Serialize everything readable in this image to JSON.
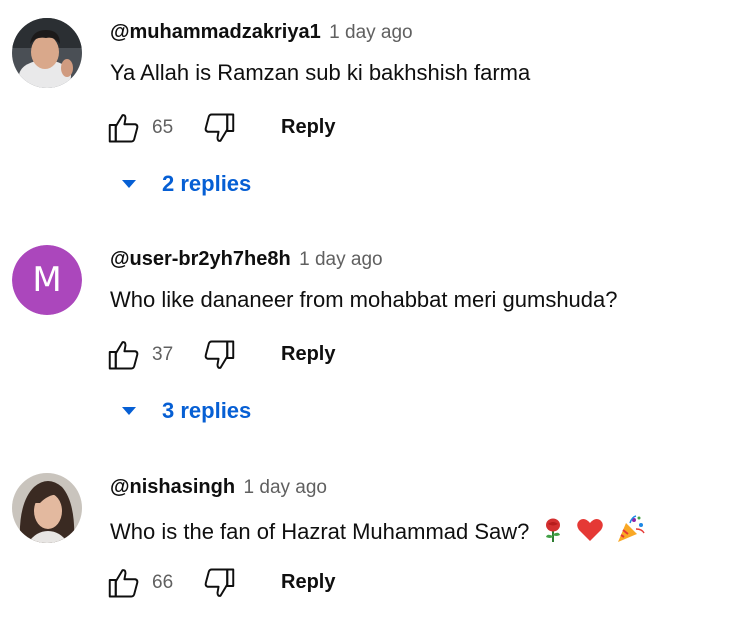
{
  "comments": [
    {
      "author": "@muhammadzakriya1",
      "time": "1 day ago",
      "text": "Ya Allah is Ramzan sub ki bakhshish farma",
      "likes": "65",
      "reply_label": "Reply",
      "replies_label": "2 replies",
      "avatar": "photo"
    },
    {
      "author": "@user-br2yh7he8h",
      "time": "1 day ago",
      "text": "Who like dananeer from mohabbat meri gumshuda?",
      "likes": "37",
      "reply_label": "Reply",
      "replies_label": "3 replies",
      "avatar_letter": "M",
      "avatar_color": "#ab47bc"
    },
    {
      "author": "@nishasingh",
      "time": "1 day ago",
      "text": "Who is the fan of Hazrat Muhammad Saw?",
      "emojis": [
        "rose-icon",
        "heart-icon",
        "party-popper-icon"
      ],
      "likes": "66",
      "reply_label": "Reply",
      "avatar": "photo"
    }
  ],
  "colors": {
    "link_blue": "#065fd4",
    "muted": "#606060",
    "text": "#0f0f0f"
  }
}
